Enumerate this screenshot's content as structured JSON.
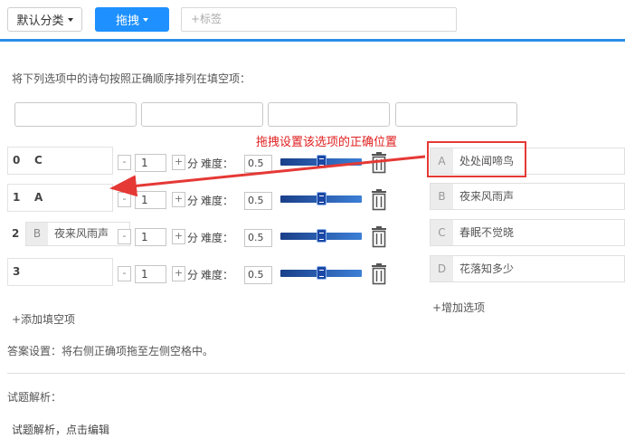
{
  "toolbar": {
    "category_label": "默认分类",
    "mode_label": "拖拽",
    "tag_placeholder": "+标签"
  },
  "question": {
    "instruction": "将下列选项中的诗句按照正确顺序排列在填空项："
  },
  "annotation": {
    "text": "拖拽设置该选项的正确位置",
    "color": "#e02020"
  },
  "blanks": [
    {
      "index": "0",
      "answer": "C",
      "score": "1",
      "difficulty_label": "难度：",
      "score_unit": "分",
      "difficulty": "0.5",
      "slider_level": 0.5
    },
    {
      "index": "1",
      "answer": "A",
      "score": "1",
      "difficulty_label": "难度：",
      "score_unit": "分",
      "difficulty": "0.5",
      "slider_level": 0.5
    },
    {
      "index": "2",
      "answer_letter": "B",
      "answer_text": "夜来风雨声",
      "score": "1",
      "difficulty_label": "难度：",
      "score_unit": "分",
      "difficulty": "0.5",
      "slider_level": 0.5
    },
    {
      "index": "3",
      "answer": "",
      "score": "1",
      "difficulty_label": "难度：",
      "score_unit": "分",
      "difficulty": "0.5",
      "slider_level": 0.5
    }
  ],
  "stepper": {
    "minus": "-",
    "plus": "+"
  },
  "options": [
    {
      "letter": "A",
      "text": "处处闻啼鸟"
    },
    {
      "letter": "B",
      "text": "夜来风雨声"
    },
    {
      "letter": "C",
      "text": "春眠不觉晓"
    },
    {
      "letter": "D",
      "text": "花落知多少"
    }
  ],
  "actions": {
    "add_blank": "+添加填空项",
    "add_option": "+增加选项"
  },
  "answer_note": "答案设置：将右侧正确项拖至左侧空格中。",
  "explanation": {
    "label": "试题解析：",
    "edit_prompt": "试题解析，点击编辑"
  },
  "colors": {
    "primary": "#1e90ff",
    "accent_line": "#2b8fe8",
    "highlight": "#e53935"
  }
}
